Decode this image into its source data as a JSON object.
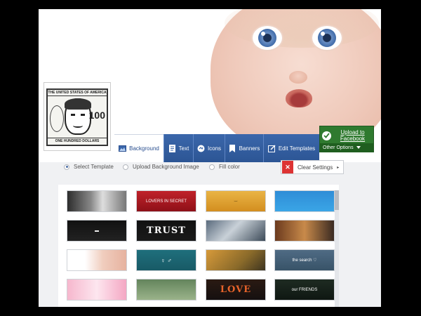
{
  "profile": {
    "bill_top_text": "THE UNITED STATES OF AMERICA",
    "bill_denomination": "100",
    "bill_bottom_text": "ONE HUNDRED DOLLARS"
  },
  "tabs": [
    {
      "label": "Background",
      "icon": "image-icon",
      "active": true
    },
    {
      "label": "Text",
      "icon": "text-icon",
      "active": false
    },
    {
      "label": "Icons",
      "icon": "icons-icon",
      "active": false
    },
    {
      "label": "Banners",
      "icon": "bookmark-icon",
      "active": false
    },
    {
      "label": "Edit Templates",
      "icon": "edit-icon",
      "active": false
    }
  ],
  "facebook": {
    "upload_label": "Upload to Facebook",
    "other_options_label": "Other Options",
    "color": "#2f7a2f"
  },
  "options": {
    "select_template": "Select Template",
    "upload_background": "Upload Background Image",
    "fill_color": "Fill color",
    "selected": "select_template",
    "clear_settings": "Clear Settings"
  },
  "templates": [
    {
      "name": "rainy-window",
      "caption": "",
      "bg": "linear-gradient(90deg,#2d2d2d,#888 40%,#ddd 60%,#777)"
    },
    {
      "name": "red-quote",
      "caption": "LOVERS IN SECRET",
      "bg": "linear-gradient(#c0222a,#8e1018)"
    },
    {
      "name": "yellow-smile",
      "caption": "⌣",
      "bg": "linear-gradient(#e9b446,#d38e1f)"
    },
    {
      "name": "blue-icons",
      "caption": "",
      "bg": "linear-gradient(#2f8dd7,#3aa5e6)"
    },
    {
      "name": "black-tag",
      "caption": "▬",
      "bg": "linear-gradient(#111,#222)"
    },
    {
      "name": "trust",
      "caption": "TRUST",
      "bg": "linear-gradient(#111,#1a1a1a)"
    },
    {
      "name": "car",
      "caption": "",
      "bg": "linear-gradient(135deg,#5a6b7d,#c9d1d8 45%,#3c4a58)"
    },
    {
      "name": "girl-room",
      "caption": "",
      "bg": "linear-gradient(90deg,#6b3a1e,#c88a4a 50%,#3a2a22)"
    },
    {
      "name": "baby-small",
      "caption": "",
      "bg": "linear-gradient(90deg,#fff 30%,#f0cdbe 60%,#e6b29f)"
    },
    {
      "name": "teal-figures",
      "caption": "♀ ♂",
      "bg": "linear-gradient(#1f6f7c,#185a66)"
    },
    {
      "name": "autumn-road",
      "caption": "",
      "bg": "linear-gradient(135deg,#d79a3a,#8a6a2a 60%,#3d3420)"
    },
    {
      "name": "blue-heart",
      "caption": "the search ♡",
      "bg": "linear-gradient(#4f6b84,#385368)"
    },
    {
      "name": "hello-kitty",
      "caption": "",
      "bg": "linear-gradient(90deg,#f6b7cd,#fde6ef 50%,#f4a7c3)"
    },
    {
      "name": "green-quote",
      "caption": "",
      "bg": "linear-gradient(#63845c,#9bb38a)"
    },
    {
      "name": "love",
      "caption": "LOVE",
      "bg": "linear-gradient(#2a1a12,#151010)"
    },
    {
      "name": "friends",
      "caption": "our FRIENDS",
      "bg": "linear-gradient(#1e2b22,#0f1712)"
    }
  ]
}
